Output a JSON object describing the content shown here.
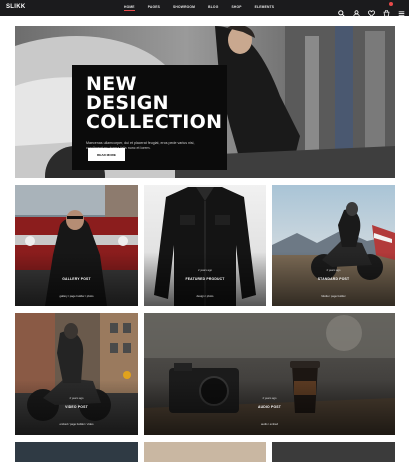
{
  "header": {
    "logo": "SLIKK",
    "nav": [
      "HOME",
      "PAGES",
      "SHOWROOM",
      "BLOG",
      "SHOP",
      "ELEMENTS"
    ],
    "active_nav": "HOME",
    "accent": "#e84a4a"
  },
  "hero": {
    "title_line1": "NEW DESIGN",
    "title_line2": "COLLECTION",
    "text": "Maecenas ullamcorper, dui et placerat feugiat, eros pede varius nisi, condimentum viverra felis nunc et lorem.",
    "button": "READ MORE"
  },
  "cards": [
    {
      "title": "GALLERY POST",
      "meta": "",
      "tags": "gallery / page builder / photo"
    },
    {
      "title": "FEATURED PRODUCT",
      "meta": "2 years ago",
      "tags": "design / photo"
    },
    {
      "title": "STANDARD POST",
      "meta": "2 years ago",
      "tags": "Media / page builder"
    },
    {
      "title": "VIDEO POST",
      "meta": "2 years ago",
      "tags": "embed / page builder / video"
    },
    {
      "title": "AUDIO POST",
      "meta": "2 years ago",
      "tags": "audio / embed"
    }
  ],
  "icons": [
    "search-icon",
    "user-icon",
    "heart-icon",
    "cart-icon",
    "menu-icon"
  ]
}
